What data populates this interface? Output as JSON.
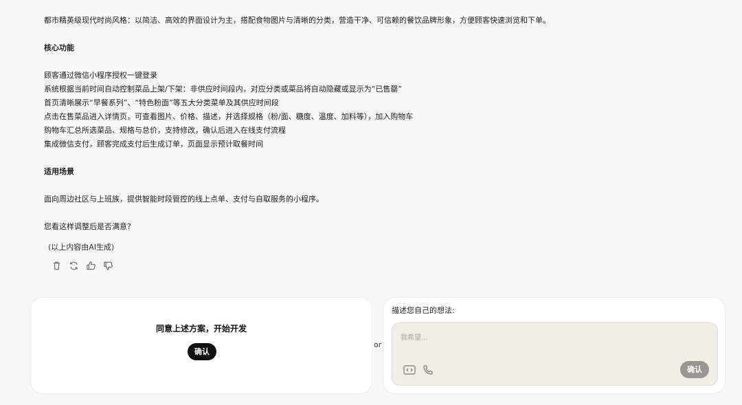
{
  "message": {
    "intro": "都市精英级现代时尚风格：以简洁、高效的界面设计为主，搭配食物图片与清晰的分类，营造干净、可信赖的餐饮品牌形象，方便顾客快速浏览和下单。",
    "core_heading": "核心功能",
    "core_items": [
      "顾客通过微信小程序授权一键登录",
      "系统根据当前时间自动控制菜品上架/下架：非供应时间段内，对应分类或菜品将自动隐藏或显示为“已售罄”",
      "首页清晰展示“早餐系列”、“特色粉面”等五大分类菜单及其供应时间段",
      "点击在售菜品进入详情页，可查看图片、价格、描述，并选择规格（粉/面、糖度、温度、加料等），加入购物车",
      "购物车汇总所选菜品、规格与总价，支持修改，确认后进入在线支付流程",
      "集成微信支付，顾客完成支付后生成订单，页面显示预计取餐时间"
    ],
    "scene_heading": "适用场景",
    "scene_text": "面向周边社区与上班族，提供智能时段管控的线上点单、支付与自取服务的小程序。",
    "question": "您看这样调整后是否满意?",
    "ai_note": "(以上内容由AI生成)"
  },
  "actions": {
    "icons": [
      "trash-icon",
      "regenerate-icon",
      "thumbs-up-icon",
      "thumbs-down-icon"
    ]
  },
  "agree_card": {
    "title": "同意上述方案，开始开发",
    "confirm_label": "确认"
  },
  "or_label": "or",
  "idea_card": {
    "label": "描述您自己的想法:",
    "placeholder": "我希望...",
    "tool_icons": [
      "code-icon",
      "phone-icon"
    ],
    "confirm_label": "确认"
  },
  "colors": {
    "background": "#f7f7f7",
    "dark_button": "#111111",
    "gray_button": "#9a9691",
    "input_bg": "#f2eee6"
  }
}
